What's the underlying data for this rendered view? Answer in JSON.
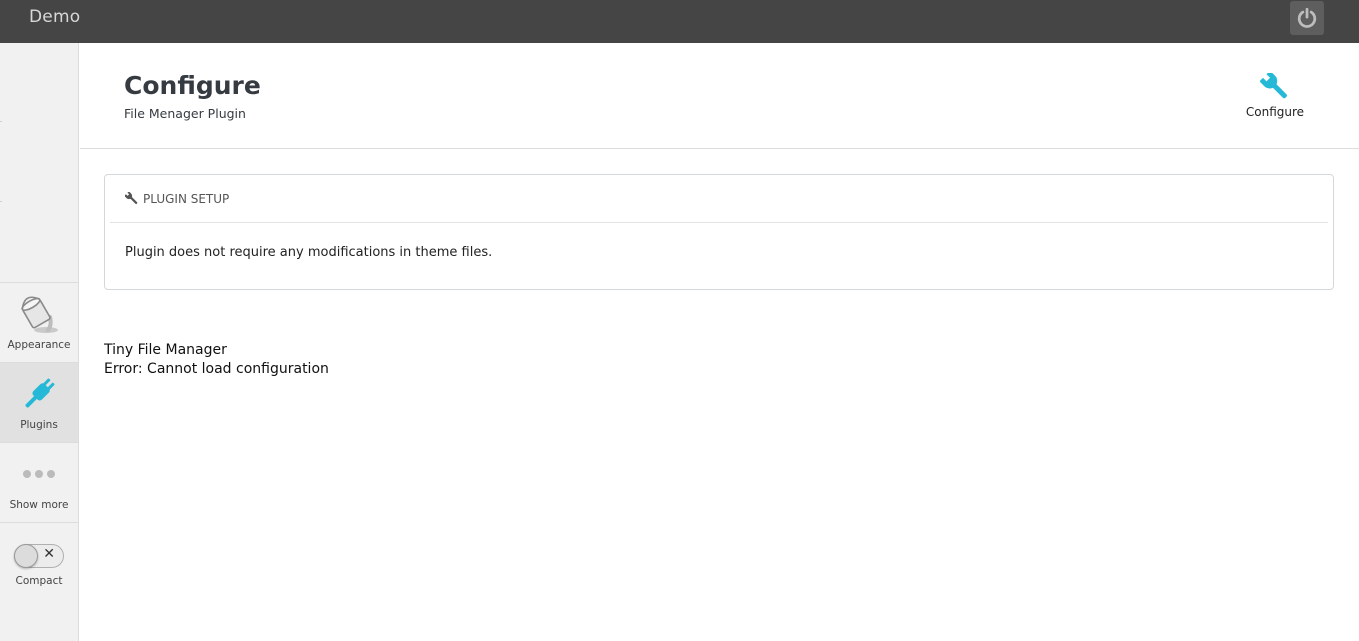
{
  "topbar": {
    "brand": "Demo",
    "power_icon": "power-icon"
  },
  "sidebar": {
    "items": [
      {
        "label": "Appearance",
        "icon": "paint-bucket-icon",
        "active": false
      },
      {
        "label": "Plugins",
        "icon": "plug-icon",
        "active": true
      },
      {
        "label": "Show more",
        "icon": "more-dots-icon",
        "active": false
      },
      {
        "label": "Compact",
        "icon": "toggle-off-icon",
        "active": false
      }
    ]
  },
  "header": {
    "title": "Configure",
    "subtitle": "File Menager Plugin",
    "toolbar": {
      "configure_label": "Configure",
      "configure_icon": "wrench-icon"
    }
  },
  "panel": {
    "heading": "PLUGIN SETUP",
    "heading_icon": "wrench-icon",
    "body": "Plugin does not require any modifications in theme files."
  },
  "content": {
    "app_name": "Tiny File Manager",
    "error": "Error: Cannot load configuration"
  },
  "colors": {
    "topbar": "#454545",
    "accent": "#25b9d7",
    "sidebar_bg": "#f1f1f1"
  }
}
